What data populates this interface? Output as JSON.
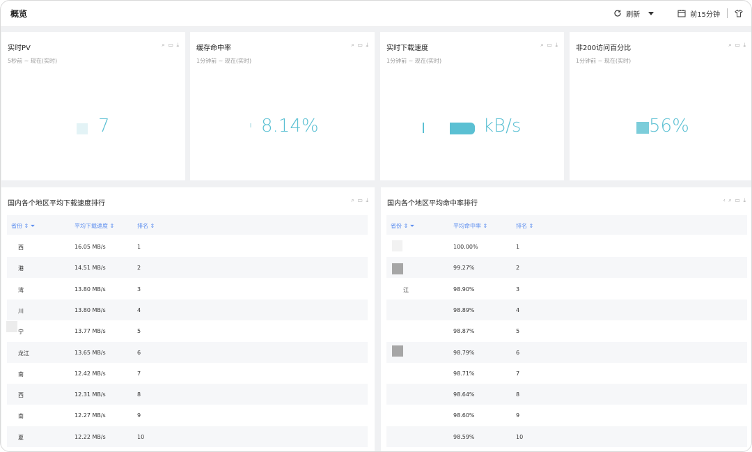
{
  "header": {
    "title": "概览",
    "refresh_label": "刷新",
    "time_range_label": "前15分钟"
  },
  "metrics": [
    {
      "title": "实时PV",
      "subtitle": "5秒前 ~ 现在(实时)",
      "value": "7",
      "tools": "⌕ ▭ ⤓"
    },
    {
      "title": "缓存命中率",
      "subtitle": "1分钟前 ~ 现在(实时)",
      "value": "8.14%",
      "tools": "⌕ ▭ ⤓"
    },
    {
      "title": "实时下载速度",
      "subtitle": "1分钟前 ~ 现在(实时)",
      "value": "kB/s",
      "tools": "⌕ ▭ ⤓"
    },
    {
      "title": "非200访问百分比",
      "subtitle": "1分钟前 ~ 现在(实时)",
      "value": "56%",
      "tools": "⌕ ▭ ⤓"
    }
  ],
  "speed_table": {
    "title": "国内各个地区平均下载速度排行",
    "tools": "⌕ ▭ ⤓",
    "columns": [
      "省份 ⇕ ⏷",
      "平均下载速度 ⇕",
      "排名 ⇕"
    ],
    "rows": [
      [
        "西",
        "16.05 MB/s",
        "1"
      ],
      [
        "港",
        "14.51 MB/s",
        "2"
      ],
      [
        "湾",
        "13.80 MB/s",
        "3"
      ],
      [
        "川",
        "13.80 MB/s",
        "4"
      ],
      [
        "宁",
        "13.77 MB/s",
        "5"
      ],
      [
        "龙江",
        "13.65 MB/s",
        "6"
      ],
      [
        "南",
        "12.42 MB/s",
        "7"
      ],
      [
        "西",
        "12.31 MB/s",
        "8"
      ],
      [
        "南",
        "12.27 MB/s",
        "9"
      ],
      [
        "夏",
        "12.22 MB/s",
        "10"
      ]
    ]
  },
  "hit_table": {
    "title": "国内各个地区平均命中率排行",
    "tools": "‹ ⌕ ▭ ⤓",
    "columns": [
      "省份 ⇕ ⏷",
      "平均命中率 ⇕",
      "排名 ⇕"
    ],
    "rows": [
      [
        "",
        "100.00%",
        "1"
      ],
      [
        "",
        "99.27%",
        "2"
      ],
      [
        "江",
        "98.90%",
        "3"
      ],
      [
        "",
        "98.89%",
        "4"
      ],
      [
        "",
        "98.87%",
        "5"
      ],
      [
        "",
        "98.79%",
        "6"
      ],
      [
        "",
        "98.71%",
        "7"
      ],
      [
        "",
        "98.64%",
        "8"
      ],
      [
        "",
        "98.60%",
        "9"
      ],
      [
        "",
        "98.59%",
        "10"
      ]
    ]
  },
  "colors": {
    "accent": "#5bc0d3",
    "header_link": "#5b8def"
  }
}
